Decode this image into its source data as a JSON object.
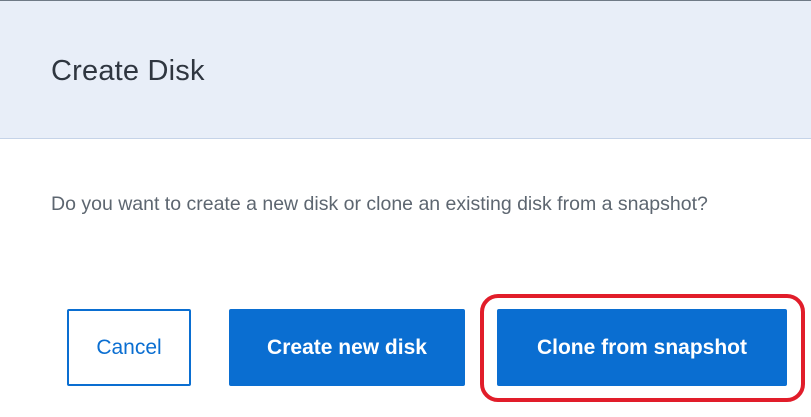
{
  "dialog": {
    "title": "Create Disk",
    "message": "Do you want to create a new disk or clone an existing disk from a snapshot?"
  },
  "buttons": {
    "cancel_label": "Cancel",
    "create_label": "Create new disk",
    "clone_label": "Clone from snapshot"
  },
  "colors": {
    "header_background": "#e8eef8",
    "primary": "#0a6ed1",
    "highlight": "#e11d2a"
  }
}
